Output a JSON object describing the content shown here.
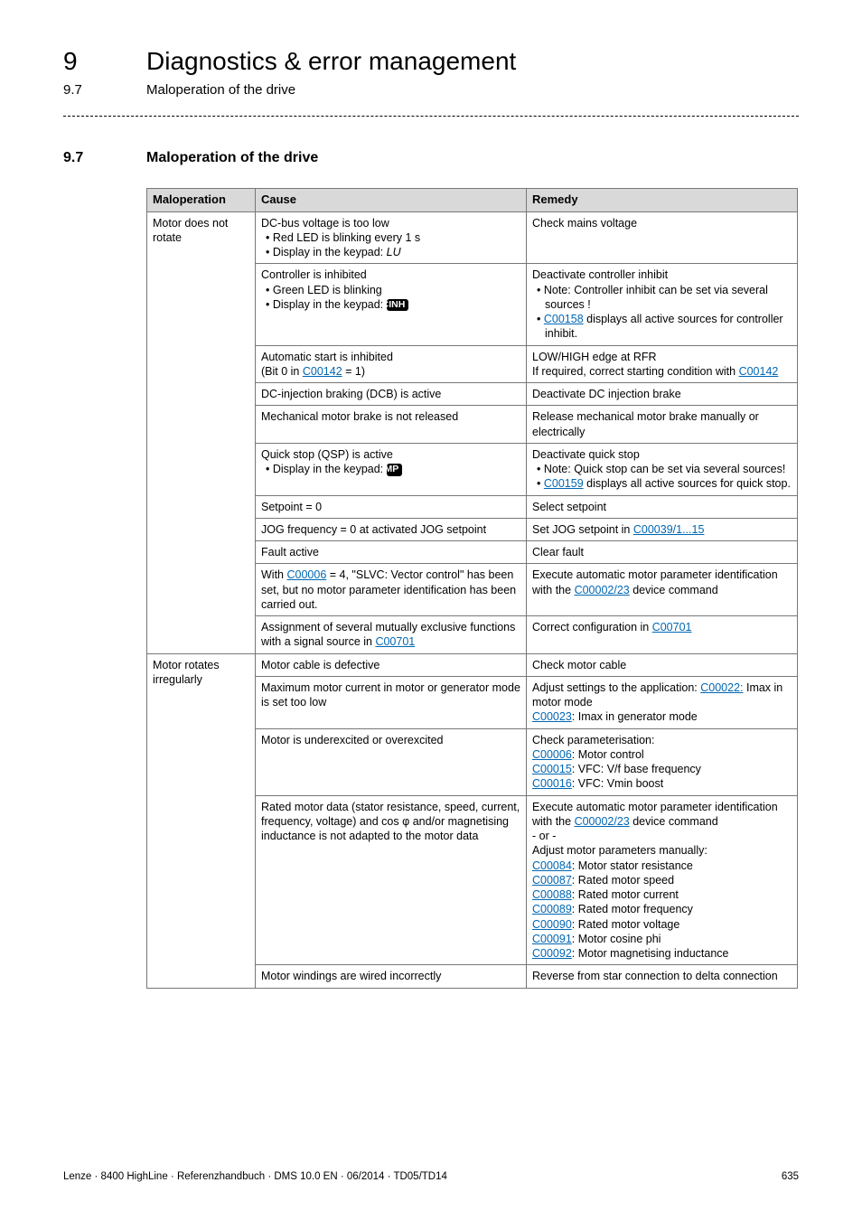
{
  "header": {
    "chapter_number": "9",
    "chapter_title": "Diagnostics & error management",
    "section_number_small": "9.7",
    "section_title_small": "Maloperation of the drive"
  },
  "section": {
    "number": "9.7",
    "title": "Maloperation of the drive"
  },
  "table": {
    "headers": {
      "maloperation": "Maloperation",
      "cause": "Cause",
      "remedy": "Remedy"
    },
    "group1_label": "Motor does not rotate",
    "group2_label": "Motor rotates irregularly",
    "r1": {
      "cause_line1": "DC-bus voltage is too low",
      "cause_b1": "Red LED is blinking every 1 s",
      "cause_b2_pre": "Display in the keypad: ",
      "cause_b2_val": "LU",
      "rem": "Check mains voltage"
    },
    "r2": {
      "cause_line1": "Controller is inhibited",
      "cause_b1": "Green LED is blinking",
      "cause_b2_pre": "Display in the keypad: ",
      "cause_badge": "CINH",
      "rem_line1": "Deactivate controller inhibit",
      "rem_b1": "Note: Controller inhibit can be set via several sources !",
      "rem_b2_link": "C00158",
      "rem_b2_rest": " displays all active sources for controller inhibit."
    },
    "r3": {
      "cause_line1": "Automatic start is inhibited",
      "cause_line2_pre": "(Bit 0 in ",
      "cause_line2_link": "C00142",
      "cause_line2_post": " = 1)",
      "rem_line1": "LOW/HIGH edge at RFR",
      "rem_line2": "If required, correct starting condition with ",
      "rem_link": "C00142"
    },
    "r4": {
      "cause": "DC-injection braking (DCB) is active",
      "rem": "Deactivate DC injection brake"
    },
    "r5": {
      "cause": "Mechanical motor brake is not released",
      "rem": "Release mechanical motor brake manually or electrically"
    },
    "r6": {
      "cause_line1": "Quick stop (QSP) is active",
      "cause_b1_pre": "Display in the keypad: ",
      "cause_badge": "IMP",
      "rem_line1": "Deactivate quick stop",
      "rem_b1": "Note: Quick stop can be set via several sources!",
      "rem_b2_link": "C00159",
      "rem_b2_rest": " displays all active sources for quick stop."
    },
    "r7": {
      "cause": "Setpoint = 0",
      "rem": "Select setpoint"
    },
    "r8": {
      "cause": "JOG frequency = 0 at activated JOG setpoint",
      "rem_pre": "Set JOG setpoint in ",
      "rem_link": "C00039/1...15"
    },
    "r9": {
      "cause": "Fault active",
      "rem": "Clear fault"
    },
    "r10": {
      "cause_pre": "With ",
      "cause_link": "C00006",
      "cause_post": " = 4, \"SLVC: Vector control\" has been set, but no motor parameter identification has been carried out.",
      "rem_pre": "Execute automatic motor parameter identification with the ",
      "rem_link": "C00002/23",
      "rem_post": " device command"
    },
    "r11": {
      "cause_pre": "Assignment of several mutually exclusive functions with a signal source in ",
      "cause_link": "C00701",
      "rem_pre": "Correct configuration in ",
      "rem_link": "C00701"
    },
    "r12": {
      "cause": "Motor cable is defective",
      "rem": "Check motor cable"
    },
    "r13": {
      "cause": "Maximum motor current in motor or generator mode is set too low",
      "rem_pre": "Adjust settings to the application: ",
      "rem_link1": "C00022:",
      "rem_mid": " Imax in motor mode",
      "rem_link2": "C00023",
      "rem_post": ": Imax in generator mode"
    },
    "r14": {
      "cause": "Motor is underexcited or overexcited",
      "rem_line1": "Check parameterisation:",
      "rem_l1_link": "C00006",
      "rem_l1_txt": ": Motor control",
      "rem_l2_link": "C00015",
      "rem_l2_txt": ": VFC: V/f base frequency",
      "rem_l3_link": "C00016",
      "rem_l3_txt": ": VFC: Vmin boost"
    },
    "r15": {
      "cause": "Rated motor data (stator resistance, speed, current, frequency, voltage) and cos φ and/or magnetising inductance is not adapted to the motor data",
      "rem_pre": "Execute automatic motor parameter identification with the ",
      "rem_link0": "C00002/23",
      "rem_post0": " device command",
      "rem_or": "- or -",
      "rem_line2": "Adjust motor parameters manually:",
      "l1_link": "C00084",
      "l1_txt": ": Motor stator resistance",
      "l2_link": "C00087",
      "l2_txt": ": Rated motor speed",
      "l3_link": "C00088",
      "l3_txt": ": Rated motor current",
      "l4_link": "C00089",
      "l4_txt": ": Rated motor frequency",
      "l5_link": "C00090",
      "l5_txt": ": Rated motor voltage",
      "l6_link": "C00091",
      "l6_txt": ": Motor cosine phi",
      "l7_link": "C00092",
      "l7_txt": ": Motor magnetising inductance"
    },
    "r16": {
      "cause": "Motor windings are wired incorrectly",
      "rem": "Reverse from star connection to delta connection"
    }
  },
  "footer": {
    "left": "Lenze · 8400 HighLine · Referenzhandbuch · DMS 10.0 EN · 06/2014 · TD05/TD14",
    "right": "635"
  }
}
